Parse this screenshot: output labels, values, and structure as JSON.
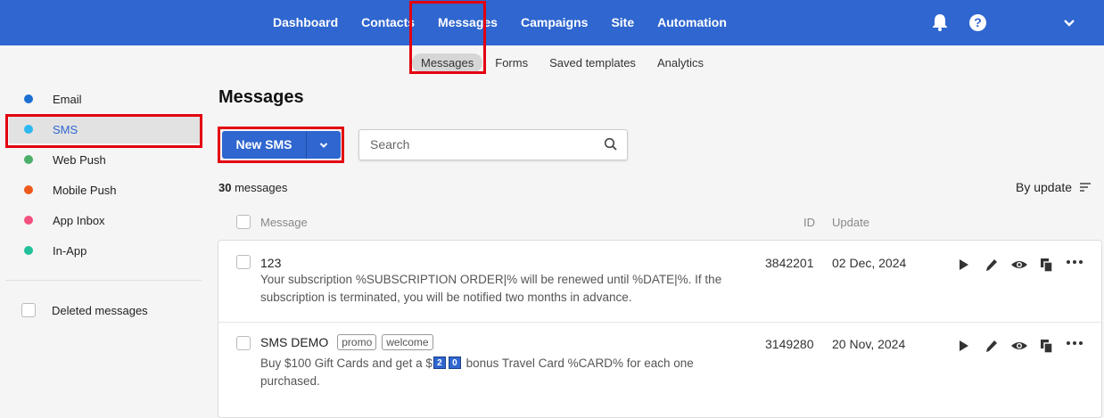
{
  "topnav": {
    "items": [
      {
        "label": "Dashboard"
      },
      {
        "label": "Contacts"
      },
      {
        "label": "Messages"
      },
      {
        "label": "Campaigns"
      },
      {
        "label": "Site"
      },
      {
        "label": "Automation"
      }
    ],
    "help_label": "?"
  },
  "subnav": {
    "items": [
      {
        "label": "Messages"
      },
      {
        "label": "Forms"
      },
      {
        "label": "Saved templates"
      },
      {
        "label": "Analytics"
      }
    ]
  },
  "sidebar": {
    "items": [
      {
        "label": "Email",
        "color": "#1a6fd1"
      },
      {
        "label": "SMS",
        "color": "#2db8f0"
      },
      {
        "label": "Web Push",
        "color": "#4caf6a"
      },
      {
        "label": "Mobile Push",
        "color": "#ee5a1c"
      },
      {
        "label": "App Inbox",
        "color": "#f2517e"
      },
      {
        "label": "In-App",
        "color": "#21c09a"
      }
    ],
    "deleted_label": "Deleted messages"
  },
  "main": {
    "title": "Messages",
    "new_button_label": "New SMS",
    "search_placeholder": "Search",
    "count_number": "30",
    "count_label": "messages",
    "sort_label": "By update",
    "columns": {
      "message": "Message",
      "id": "ID",
      "update": "Update"
    }
  },
  "rows": [
    {
      "name": "123",
      "tags": [],
      "desc_line1": "Your subscription %SUBSCRIPTION ORDER|% will be renewed until %DATE|%. If the",
      "desc_line2": "subscription is terminated, you will be notified two months in advance.",
      "id": "3842201",
      "date": "02 Dec, 2024"
    },
    {
      "name": "SMS DEMO",
      "tags": [
        "promo",
        "welcome"
      ],
      "desc_pre": "Buy $100 Gift Cards and get a $",
      "desc_badges": [
        "2",
        "0"
      ],
      "desc_post": " bonus Travel Card %CARD% for each one",
      "desc_line2": "purchased.",
      "id": "3149280",
      "date": "20 Nov, 2024"
    }
  ],
  "colors": {
    "brand": "#2f66cf",
    "highlight": "#e3000f"
  }
}
